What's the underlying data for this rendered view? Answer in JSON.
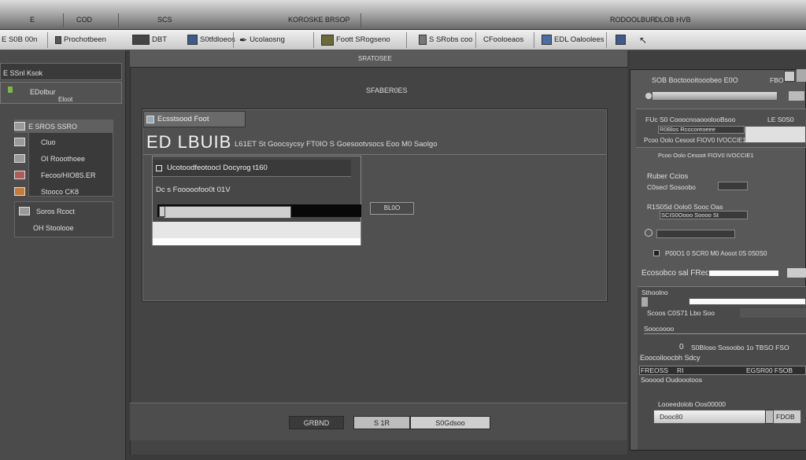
{
  "menubar": {
    "items": [
      "E",
      "COD",
      "SCS",
      "KOROSKE BRSOP",
      "RODOOLBUR",
      "DLOB HVB"
    ]
  },
  "toolbar": {
    "items": [
      {
        "label": "E S0B 00n"
      },
      {
        "label": "Prochotbeen"
      },
      {
        "label": "DBT"
      },
      {
        "label": "S0tfdloeos"
      },
      {
        "label": "Ucolaosng"
      },
      {
        "label": "Foott SRogseno"
      },
      {
        "label": "S SRobs coo"
      },
      {
        "label": "CFooloeaos"
      },
      {
        "label": "EDL Oaloolees"
      }
    ]
  },
  "leftpanel": {
    "header": "E SSnl Ksok",
    "sub1": "EDolbur",
    "sub2": "Eloot",
    "items": [
      {
        "label": "E SROS SSRO"
      },
      {
        "label": "Cluo"
      },
      {
        "label": "OI Rooothoee"
      },
      {
        "label": "Fecoo/HIO8S.ER"
      },
      {
        "label": "Stooco CK8"
      },
      {
        "label": "Soros Rcoct"
      },
      {
        "label": "OH Stoolooe"
      }
    ]
  },
  "center": {
    "header": "SRATOSEE",
    "top_caption": "SFABER0ES",
    "dialog_tab": "Ecsstsood Foot",
    "title": "ED LBUIB",
    "title_sub": "L61ET St Goocsycsy FT0IO S Goesootvsocs Eoo M0 Saolgo",
    "sub_head": "Ucotoodfeotoocl Docyrog t160",
    "sub_line2": "Dc s Fooooofoo0t 01V",
    "small_button": "BL0O",
    "buttons": {
      "left": "GRBND",
      "mid": "S 1R",
      "right": "S0Gdsoo"
    }
  },
  "rightpanel": {
    "title": "SOB Boctoooitooobeo E0O",
    "topcaption": "FBO",
    "row1_label": "FUc S0 CooocnoaooolooBsoo",
    "row1_value": "LE S0S0",
    "row2_label": "R0Blos Rcocoreoeee",
    "row3_label": "Pcoo Oolo Cesoot FIOV0 IVOCCIE1",
    "section1": "Ruber Ccios",
    "row4_label": "C0secl Sosoobo",
    "row5_label": "R1S0Sd Oolo0 Sooc Oas",
    "row6_label": "SCIS0Oooo Soooo St",
    "row7_label": "P00O1 0 SCR0 M0 Aooot 0S 0S0S0",
    "eco_label": "Ecosobco sal FReoaoe",
    "row8_label": "Sthoolno",
    "row9_label": "Scoos C0S71 Lbo Soo",
    "row10_label": "Soocoooo",
    "row11_value": "0",
    "row11_label": "S0Bloso Sosoobo 1o TBSO FSO",
    "row12_label": "Eoocoiloocbh Sdcy",
    "row13_label": "FREOSS",
    "row13_value": "RI",
    "row13_value2": "EGSR00 FSOB",
    "row14_label": "Sooood Oudoootoos",
    "row15_label": "Looeedolob Oos00000",
    "footer_field": "Dooc80",
    "footer_button": "FDOB"
  }
}
